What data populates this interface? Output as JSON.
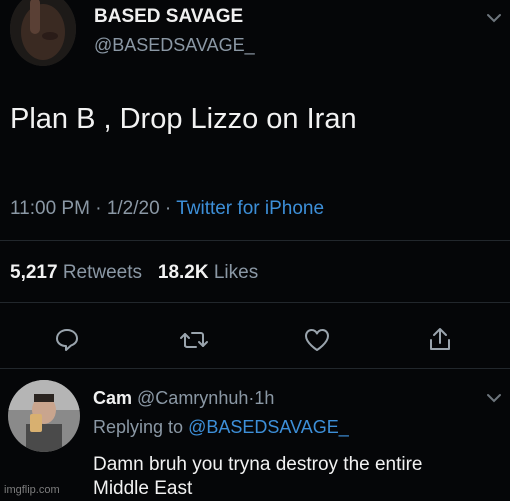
{
  "tweet": {
    "display_name": "BASED SAVAGE",
    "handle": "@BASEDSAVAGE_",
    "text": "Plan B , Drop Lizzo on Iran",
    "time": "11:00 PM",
    "date_sep": "·",
    "date": "1/2/20",
    "source_sep": "·",
    "source": "Twitter for iPhone",
    "retweets_count": "5,217",
    "retweets_label": "Retweets",
    "likes_count": "18.2K",
    "likes_label": "Likes"
  },
  "actions": {
    "icons": [
      "reply-icon",
      "retweet-icon",
      "like-icon",
      "share-icon"
    ]
  },
  "reply": {
    "display_name": "Cam",
    "handle": "@Camrynhuh",
    "time_sep": "·",
    "time": "1h",
    "replying_label": "Replying to",
    "replying_to": "@BASEDSAVAGE_",
    "text_line1": "Damn bruh you tryna destroy the entire",
    "text_line2": "Middle East"
  },
  "watermark": "imgflip.com",
  "colors": {
    "background": "#050608",
    "text": "#e7e9ea",
    "muted": "#8b98a5",
    "link": "#3d8fd8"
  }
}
